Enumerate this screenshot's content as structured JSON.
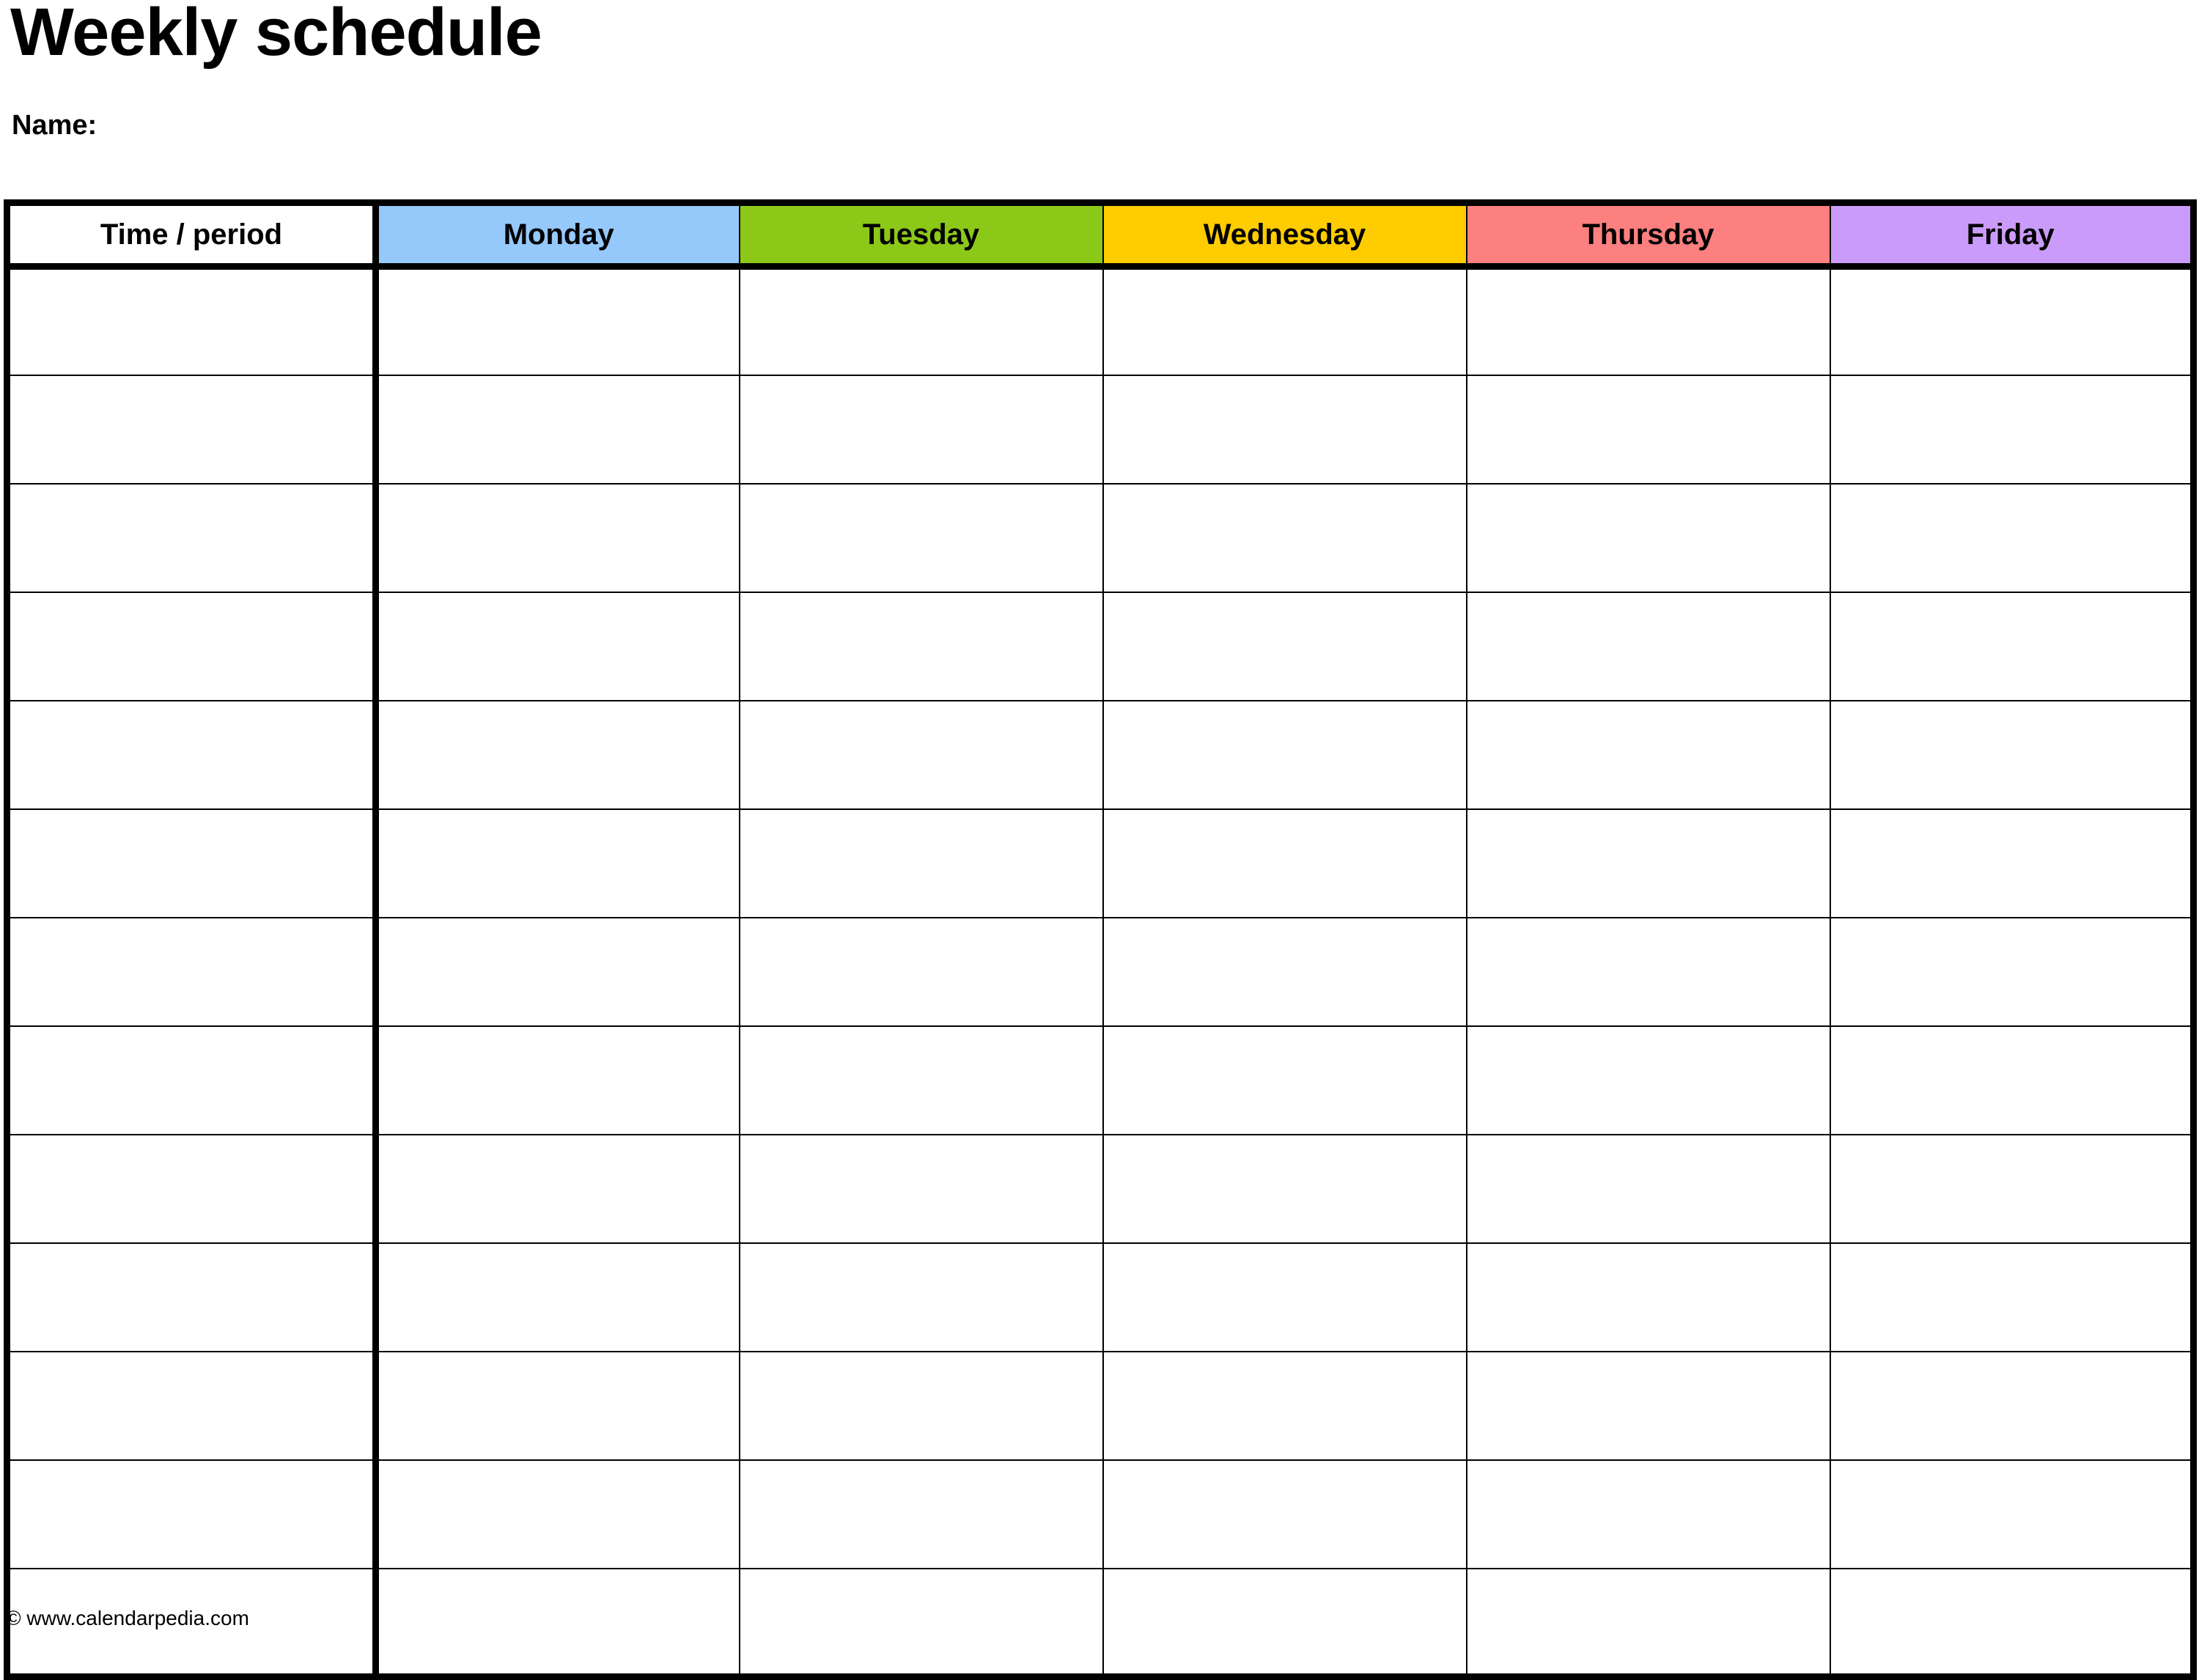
{
  "document": {
    "title": "Weekly schedule",
    "name_label": "Name:"
  },
  "table": {
    "columns": [
      {
        "key": "time",
        "label": "Time / period",
        "bg": "#FFFFFF"
      },
      {
        "key": "monday",
        "label": "Monday",
        "bg": "#95C8FB"
      },
      {
        "key": "tuesday",
        "label": "Tuesday",
        "bg": "#8CC818"
      },
      {
        "key": "wednesday",
        "label": "Wednesday",
        "bg": "#FFCC00"
      },
      {
        "key": "thursday",
        "label": "Thursday",
        "bg": "#FC8080"
      },
      {
        "key": "friday",
        "label": "Friday",
        "bg": "#CB9BFB"
      }
    ],
    "row_count": 13,
    "rows": [
      {
        "time": "",
        "monday": "",
        "tuesday": "",
        "wednesday": "",
        "thursday": "",
        "friday": ""
      },
      {
        "time": "",
        "monday": "",
        "tuesday": "",
        "wednesday": "",
        "thursday": "",
        "friday": ""
      },
      {
        "time": "",
        "monday": "",
        "tuesday": "",
        "wednesday": "",
        "thursday": "",
        "friday": ""
      },
      {
        "time": "",
        "monday": "",
        "tuesday": "",
        "wednesday": "",
        "thursday": "",
        "friday": ""
      },
      {
        "time": "",
        "monday": "",
        "tuesday": "",
        "wednesday": "",
        "thursday": "",
        "friday": ""
      },
      {
        "time": "",
        "monday": "",
        "tuesday": "",
        "wednesday": "",
        "thursday": "",
        "friday": ""
      },
      {
        "time": "",
        "monday": "",
        "tuesday": "",
        "wednesday": "",
        "thursday": "",
        "friday": ""
      },
      {
        "time": "",
        "monday": "",
        "tuesday": "",
        "wednesday": "",
        "thursday": "",
        "friday": ""
      },
      {
        "time": "",
        "monday": "",
        "tuesday": "",
        "wednesday": "",
        "thursday": "",
        "friday": ""
      },
      {
        "time": "",
        "monday": "",
        "tuesday": "",
        "wednesday": "",
        "thursday": "",
        "friday": ""
      },
      {
        "time": "",
        "monday": "",
        "tuesday": "",
        "wednesday": "",
        "thursday": "",
        "friday": ""
      },
      {
        "time": "",
        "monday": "",
        "tuesday": "",
        "wednesday": "",
        "thursday": "",
        "friday": ""
      },
      {
        "time": "",
        "monday": "",
        "tuesday": "",
        "wednesday": "",
        "thursday": "",
        "friday": ""
      }
    ]
  },
  "footer": {
    "credit": "© www.calendarpedia.com"
  },
  "colors": {
    "border": "#000000",
    "text": "#000000",
    "background": "#FFFFFF"
  }
}
